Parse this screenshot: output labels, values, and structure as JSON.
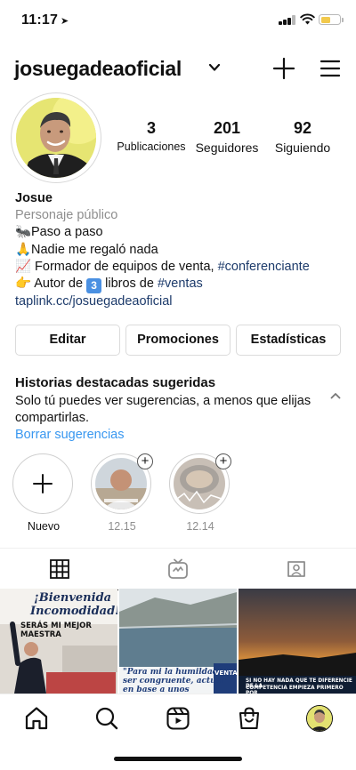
{
  "status_bar": {
    "time": "11:17",
    "location_arrow": "➤",
    "battery_level": 0.45
  },
  "header": {
    "username": "josuegadeaoficial"
  },
  "profile": {
    "stats": [
      {
        "value": "3",
        "label": "Publicaciones"
      },
      {
        "value": "201",
        "label": "Seguidores"
      },
      {
        "value": "92",
        "label": "Siguiendo"
      }
    ]
  },
  "bio": {
    "name": "Josue",
    "category": "Personaje público",
    "line1_emoji": "🐜",
    "line1": "Paso a paso",
    "line2_emoji": "🙏",
    "line2": "Nadie me regaló nada",
    "line3_emoji": "📈",
    "line3_text": "Formador de equipos de venta,",
    "line3_hashtag": "#conferenciante",
    "line4_emoji": "👉",
    "line4_prefix": "Autor de",
    "line4_number": "3",
    "line4_middle": "libros de",
    "line4_hashtag": "#ventas",
    "link": "taplink.cc/josuegadeaoficial"
  },
  "buttons": {
    "edit": "Editar",
    "promotions": "Promociones",
    "statistics": "Estadísticas"
  },
  "suggested": {
    "title": "Historias destacadas sugeridas",
    "text": "Solo tú puedes ver sugerencias, a menos que elijas compartirlas.",
    "clear": "Borrar sugerencias"
  },
  "highlights": [
    {
      "label": "Nuevo",
      "icon": "plus-icon"
    },
    {
      "label": "12.15",
      "icon": "add-icon"
    },
    {
      "label": "12.14",
      "icon": "add-icon"
    }
  ],
  "tabs": [
    {
      "icon": "grid-icon"
    },
    {
      "icon": "igtv-icon"
    },
    {
      "icon": "tagged-icon"
    }
  ],
  "posts": [
    {
      "line1": "¡Bienvenida",
      "line2": "Incomodidad!",
      "line3": "SERÁS MI MEJOR MAESTRA"
    },
    {
      "line1": "\"Para mi la humildad es",
      "line2": "ser congruente, actuar",
      "line3": "en base a unos principios",
      "badge": "VENTA"
    },
    {
      "line1": "SI NO HAY NADA QUE TE DIFERENCIE DE LA",
      "line2": "COMPETENCIA EMPIEZA PRIMERO POR"
    }
  ],
  "bottom_nav": [
    {
      "icon": "home-icon"
    },
    {
      "icon": "search-icon"
    },
    {
      "icon": "reels-icon"
    },
    {
      "icon": "shop-icon"
    },
    {
      "icon": "profile-avatar"
    }
  ]
}
